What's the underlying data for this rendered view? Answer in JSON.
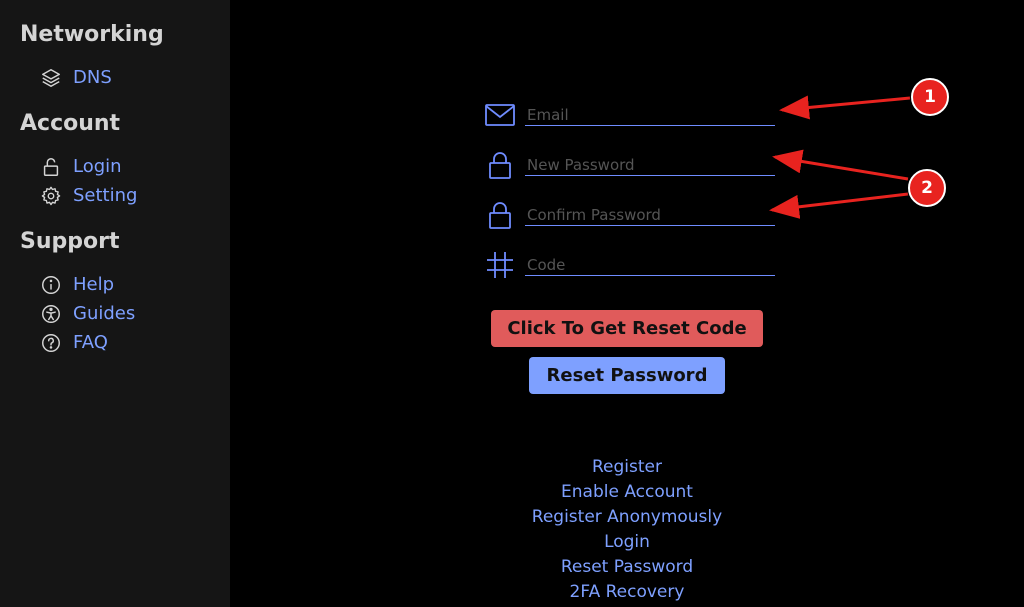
{
  "sidebar": {
    "sections": [
      {
        "title": "Networking",
        "items": [
          {
            "label": "DNS",
            "icon": "layers-icon"
          }
        ]
      },
      {
        "title": "Account",
        "items": [
          {
            "label": "Login",
            "icon": "lock-icon"
          },
          {
            "label": "Setting",
            "icon": "gear-icon"
          }
        ]
      },
      {
        "title": "Support",
        "items": [
          {
            "label": "Help",
            "icon": "info-icon"
          },
          {
            "label": "Guides",
            "icon": "accessibility-icon"
          },
          {
            "label": "FAQ",
            "icon": "question-icon"
          }
        ]
      }
    ]
  },
  "form": {
    "fields": [
      {
        "placeholder": "Email",
        "icon": "mail-icon",
        "type": "email",
        "value": ""
      },
      {
        "placeholder": "New Password",
        "icon": "lock-icon",
        "type": "password",
        "value": ""
      },
      {
        "placeholder": "Confirm Password",
        "icon": "lock-icon",
        "type": "password",
        "value": ""
      },
      {
        "placeholder": "Code",
        "icon": "hash-icon",
        "type": "text",
        "value": ""
      }
    ],
    "get_code_label": "Click To Get Reset Code",
    "reset_label": "Reset Password"
  },
  "links": [
    "Register",
    "Enable Account",
    "Register Anonymously",
    "Login",
    "Reset Password",
    "2FA Recovery"
  ],
  "annotations": {
    "badges": [
      "1",
      "2"
    ]
  },
  "colors": {
    "background": "#000000",
    "sidebar_bg": "#151515",
    "accent": "#7ea0ff",
    "danger": "#e05b5b",
    "annotation": "#e8231f"
  }
}
